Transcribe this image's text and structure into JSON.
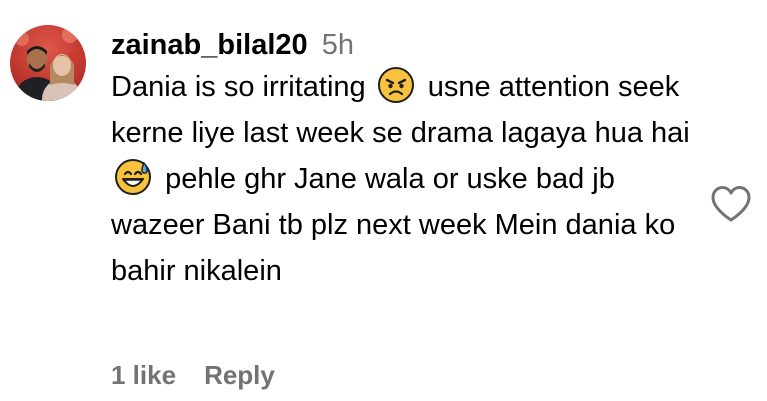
{
  "comment": {
    "username": "zainab_bilal20",
    "timestamp": "5h",
    "text_parts": {
      "p1": "Dania is so irritating",
      "p2": "usne attention seek kerne liye last week se drama lagaya hua hai",
      "p3": "pehle ghr Jane wala or uske bad jb wazeer Bani tb plz next week Mein dania ko bahir nikalein"
    },
    "emojis": [
      "angry-face-emoji",
      "grinning-face-with-sweat-emoji"
    ],
    "likes_label": "1 like",
    "reply_label": "Reply"
  },
  "colors": {
    "primary_text": "#000000",
    "secondary_text": "#737373",
    "emoji_yellow": "#F9C23C",
    "heart_outline": "#737373"
  }
}
